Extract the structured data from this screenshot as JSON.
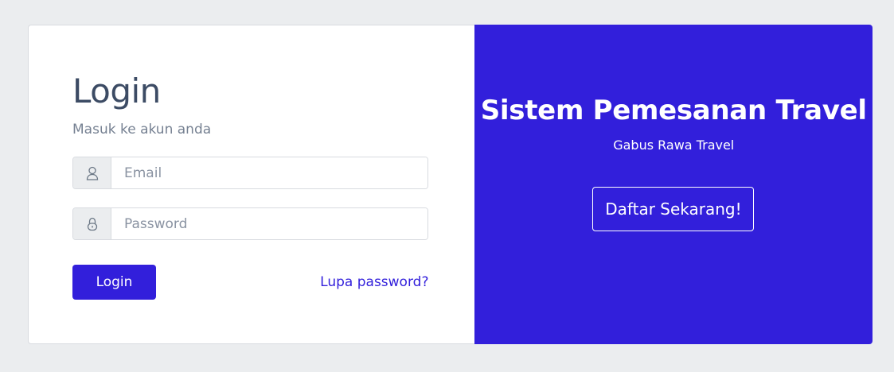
{
  "login": {
    "title": "Login",
    "subtitle": "Masuk ke akun anda",
    "email": {
      "icon": "user-icon",
      "placeholder": "Email",
      "value": ""
    },
    "password": {
      "icon": "lock-icon",
      "placeholder": "Password",
      "value": ""
    },
    "submit_label": "Login",
    "forgot_label": "Lupa password?"
  },
  "signup": {
    "title": "Sistem Pemesanan Travel",
    "subtitle": "Gabus Rawa Travel",
    "register_label": "Daftar Sekarang!"
  },
  "colors": {
    "primary": "#321fdb",
    "page_background": "#ebedef",
    "heading": "#3c4b64",
    "muted": "#768192"
  }
}
